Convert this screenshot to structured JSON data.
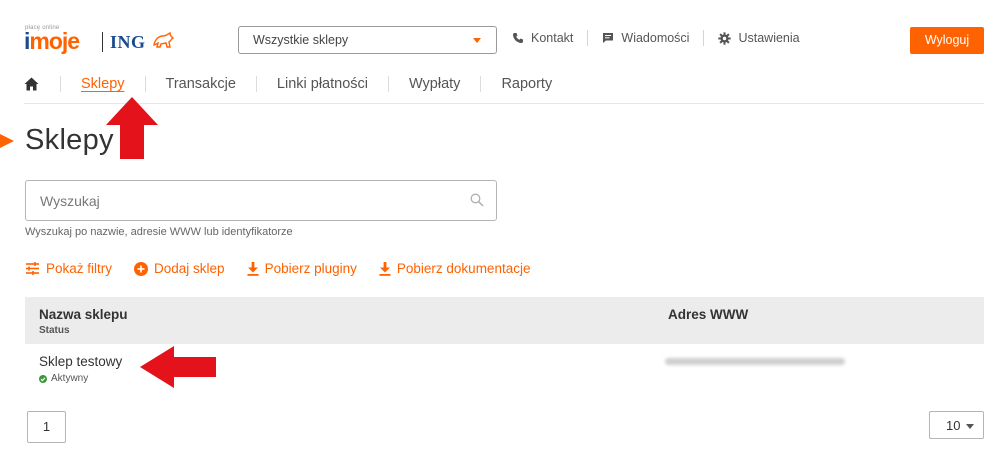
{
  "brand": {
    "tagline": "płacę online",
    "product": "imoje",
    "bank": "ING"
  },
  "header": {
    "shop_select": "Wszystkie sklepy",
    "links": [
      {
        "label": "Kontakt",
        "icon": "phone-icon"
      },
      {
        "label": "Wiadomości",
        "icon": "message-icon"
      },
      {
        "label": "Ustawienia",
        "icon": "gear-icon"
      }
    ],
    "logout": "Wyloguj"
  },
  "nav": {
    "home_icon": "home-icon",
    "items": [
      "Sklepy",
      "Transakcje",
      "Linki płatności",
      "Wypłaty",
      "Raporty"
    ],
    "active": "Sklepy"
  },
  "page": {
    "title": "Sklepy"
  },
  "search": {
    "placeholder": "Wyszukaj",
    "hint": "Wyszukaj po nazwie, adresie WWW lub identyfikatorze"
  },
  "actions": [
    {
      "label": "Pokaż filtry",
      "icon": "filter-icon"
    },
    {
      "label": "Dodaj sklep",
      "icon": "plus-circle-icon"
    },
    {
      "label": "Pobierz pluginy",
      "icon": "download-icon"
    },
    {
      "label": "Pobierz dokumentacje",
      "icon": "download-icon"
    }
  ],
  "table": {
    "col_name": "Nazwa sklepu",
    "col_status": "Status",
    "col_www": "Adres WWW",
    "rows": [
      {
        "name": "Sklep testowy",
        "status": "Aktywny"
      }
    ]
  },
  "pagination": {
    "page": "1",
    "per_page": "10"
  },
  "colors": {
    "accent": "#ff6200",
    "brand_blue": "#1b4a8e",
    "annotation_arrow": "#e3121b",
    "status_active": "#3a9a3a"
  }
}
